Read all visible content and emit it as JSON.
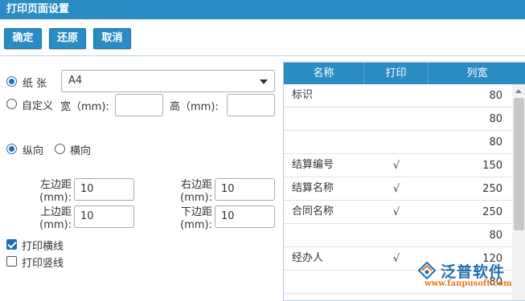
{
  "window": {
    "title": "打印页面设置"
  },
  "toolbar": {
    "confirm": "确定",
    "restore": "还原",
    "cancel": "取消"
  },
  "paper": {
    "paper_label": "纸 张",
    "paper_selected": true,
    "paper_size": "A4",
    "custom_label": "自定义",
    "custom_selected": false,
    "width_label": "宽（mm):",
    "height_label": "高（mm):",
    "width_value": "",
    "height_value": ""
  },
  "orientation": {
    "portrait": "纵向",
    "landscape": "横向",
    "selected": "portrait"
  },
  "margins": {
    "left_label": "左边距(mm):",
    "left_value": "10",
    "right_label": "右边距(mm):",
    "right_value": "10",
    "top_label": "上边距(mm):",
    "top_value": "10",
    "bottom_label": "下边距(mm):",
    "bottom_value": "10"
  },
  "options": {
    "hlines_label": "打印横线",
    "hlines_checked": true,
    "vlines_label": "打印竖线",
    "vlines_checked": false
  },
  "grid": {
    "headers": [
      "名称",
      "打印",
      "列宽"
    ],
    "rows": [
      {
        "name": "标识",
        "print": "",
        "width": "80"
      },
      {
        "name": "",
        "print": "",
        "width": "80"
      },
      {
        "name": "",
        "print": "",
        "width": "80"
      },
      {
        "name": "结算编号",
        "print": "√",
        "width": "150"
      },
      {
        "name": "结算名称",
        "print": "√",
        "width": "250"
      },
      {
        "name": "合同名称",
        "print": "√",
        "width": "250"
      },
      {
        "name": "",
        "print": "",
        "width": "80"
      },
      {
        "name": "经办人",
        "print": "√",
        "width": "120"
      },
      {
        "name": "",
        "print": "",
        "width": "80"
      }
    ]
  },
  "watermark": {
    "name": "泛普软件",
    "url": "www.fanpusoft.com"
  },
  "colors": {
    "accent": "#2b8cc4",
    "brand_orange": "#e07a1f"
  }
}
